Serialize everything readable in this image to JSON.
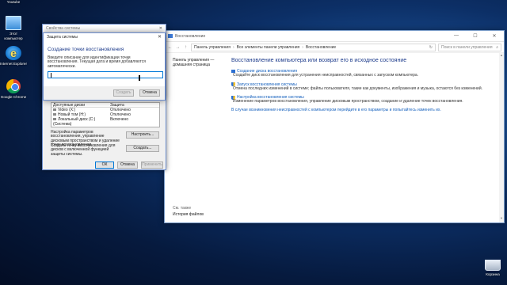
{
  "desktop": {
    "icons": [
      {
        "label": "Youtube",
        "icon": "youtube-icon"
      },
      {
        "label": "Этот компьютер",
        "icon": "computer-icon"
      },
      {
        "label": "Internet Explorer",
        "icon": "internet-explorer-icon"
      },
      {
        "label": "Google Chrome",
        "icon": "chrome-icon"
      },
      {
        "label": "Корзина",
        "icon": "recycle-bin-icon"
      }
    ]
  },
  "explorer": {
    "title": "Восстановление",
    "controls": {
      "minimize": "—",
      "maximize": "☐",
      "close": "✕"
    },
    "breadcrumb": [
      "Панель управления",
      "Все элементы панели управления",
      "Восстановление"
    ],
    "search_placeholder": "Поиск в панели управления",
    "left_pane": {
      "home": "Панель управления — домашняя страница",
      "see_also": "См. также",
      "file_history": "История файлов"
    },
    "heading": "Восстановление компьютера или возврат его в исходное состояние",
    "tasks": [
      {
        "link": "Создание диска восстановления",
        "desc": "Создайте диск восстановления для устранения неисправностей, связанных с запуском компьютера."
      },
      {
        "link": "Запуск восстановления системы",
        "desc": "Отмена последних изменений в системе; файлы пользователя, такие как документы, изображения и музыка, остаются без изменений."
      },
      {
        "link": "Настройка восстановления системы",
        "desc": "Изменение параметров восстановления, управление дисковым пространством, создание и удаление точек восстановления."
      }
    ],
    "tip": "В случае возникновения неисправностей с компьютером перейдите в его параметры и попытайтесь изменить их."
  },
  "system_properties": {
    "title": "Свойства системы",
    "close": "✕",
    "columns": [
      "Доступные диски",
      "Защита"
    ],
    "drives": [
      {
        "name": "Video (X:)",
        "protection": "Отключено"
      },
      {
        "name": "Новый том (H:)",
        "protection": "Отключено"
      },
      {
        "name": "Локальный диск (C:) (Система)",
        "protection": "Включено"
      }
    ],
    "configure_text": "Настройка параметров восстановления, управление дисковым пространством и удаление точек восстановления.",
    "configure_button": "Настроить...",
    "create_text": "Создать точку восстановления для дисков с включенной функцией защиты системы.",
    "create_button": "Создать...",
    "ok": "ОК",
    "cancel": "Отмена",
    "apply": "Применить"
  },
  "create_dialog": {
    "title": "Защита системы",
    "close": "✕",
    "heading": "Создание точки восстановления",
    "instruction": "Введите описание для идентификации точки восстановления. Текущая дата и время добавляются автоматически.",
    "input_value": "",
    "create_button": "Создать",
    "cancel_button": "Отмена"
  }
}
